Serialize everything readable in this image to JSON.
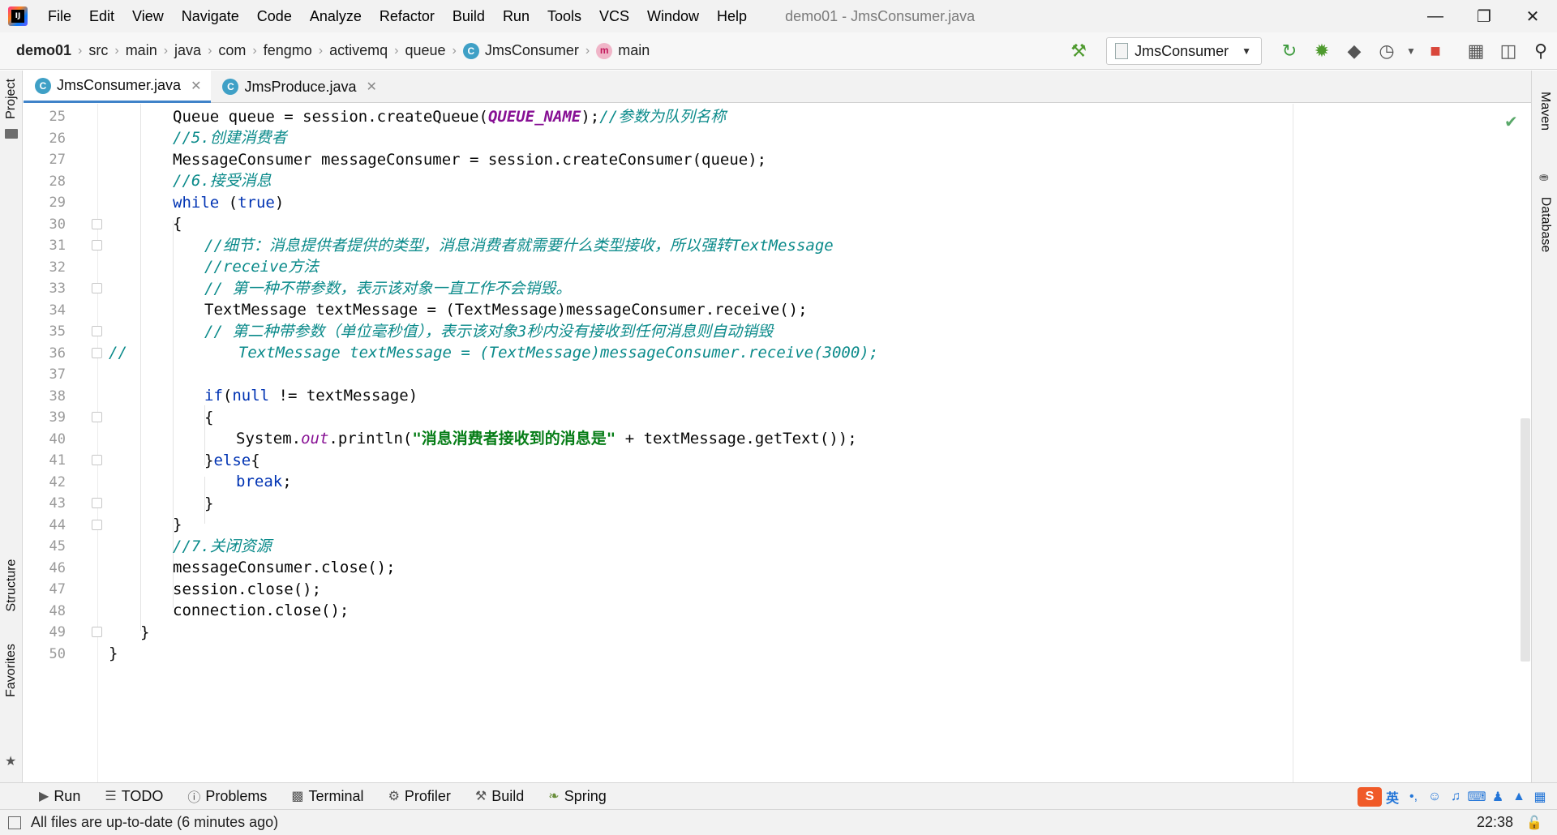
{
  "app": {
    "logo_text": "IJ",
    "window_title": "demo01 - JmsConsumer.java"
  },
  "menu": [
    "File",
    "Edit",
    "View",
    "Navigate",
    "Code",
    "Analyze",
    "Refactor",
    "Build",
    "Run",
    "Tools",
    "VCS",
    "Window",
    "Help"
  ],
  "breadcrumb": {
    "items": [
      "demo01",
      "src",
      "main",
      "java",
      "com",
      "fengmo",
      "activemq",
      "queue"
    ],
    "class_name": "JmsConsumer",
    "method_name": "main"
  },
  "toolbar": {
    "run_config": "JmsConsumer",
    "icons": [
      "build-hammer-icon",
      "rerun-icon",
      "debug-icon",
      "coverage-icon",
      "profile-icon",
      "stop-icon",
      "project-structure-icon",
      "terminal-icon",
      "search-icon"
    ]
  },
  "left_strip": {
    "project_label": "Project",
    "structure_label": "Structure",
    "favorites_label": "Favorites"
  },
  "right_strip": {
    "maven_label": "Maven",
    "database_label": "Database"
  },
  "tabs": [
    {
      "label": "JmsConsumer.java",
      "active": true
    },
    {
      "label": "JmsProduce.java",
      "active": false
    }
  ],
  "editor": {
    "lines": [
      {
        "n": "25",
        "indent": 2
      },
      {
        "n": "26",
        "indent": 2
      },
      {
        "n": "27",
        "indent": 2
      },
      {
        "n": "28",
        "indent": 2
      },
      {
        "n": "29",
        "indent": 2
      },
      {
        "n": "30",
        "indent": 2
      },
      {
        "n": "31",
        "indent": 3
      },
      {
        "n": "32",
        "indent": 3
      },
      {
        "n": "33",
        "indent": 3
      },
      {
        "n": "34",
        "indent": 3
      },
      {
        "n": "35",
        "indent": 3
      },
      {
        "n": "36",
        "indent": 0
      },
      {
        "n": "37",
        "indent": 0
      },
      {
        "n": "38",
        "indent": 3
      },
      {
        "n": "39",
        "indent": 3
      },
      {
        "n": "40",
        "indent": 4
      },
      {
        "n": "41",
        "indent": 3
      },
      {
        "n": "42",
        "indent": 4
      },
      {
        "n": "43",
        "indent": 3
      },
      {
        "n": "44",
        "indent": 2
      },
      {
        "n": "45",
        "indent": 2
      },
      {
        "n": "46",
        "indent": 2
      },
      {
        "n": "47",
        "indent": 2
      },
      {
        "n": "48",
        "indent": 2
      },
      {
        "n": "49",
        "indent": 1
      },
      {
        "n": "50",
        "indent": 0
      }
    ],
    "code": {
      "l25a": "Queue queue = session.createQueue(",
      "l25b": "QUEUE_NAME",
      "l25c": ");",
      "l25d": "//参数为队列名称",
      "l26": "//5.创建消费者",
      "l27": "MessageConsumer messageConsumer = session.createConsumer(queue);",
      "l28": "//6.接受消息",
      "l29a": "while",
      "l29b": " (",
      "l29c": "true",
      "l29d": ")",
      "l30": "{",
      "l31": "//细节：消息提供者提供的类型，消息消费者就需要什么类型接收，所以强转TextMessage",
      "l32": "//receive方法",
      "l33": "// 第一种不带参数，表示该对象一直工作不会销毁。",
      "l34": "TextMessage textMessage = (TextMessage)messageConsumer.receive();",
      "l35": "// 第二种带参数（单位毫秒值），表示该对象3秒内没有接收到任何消息则自动销毁",
      "l36a": "//",
      "l36b": "TextMessage textMessage = (TextMessage)messageConsumer.receive(3000);",
      "l38a": "if",
      "l38b": "(",
      "l38c": "null",
      "l38d": " != textMessage)",
      "l39": "{",
      "l40a": "System.",
      "l40b": "out",
      "l40c": ".println(",
      "l40d": "\"消息消费者接收到的消息是\"",
      "l40e": " + textMessage.getText());",
      "l41a": "}",
      "l41b": "else",
      "l41c": "{",
      "l42": "break",
      "l42b": ";",
      "l43": "}",
      "l44": "}",
      "l45": "//7.关闭资源",
      "l46": "messageConsumer.close();",
      "l47": "session.close();",
      "l48": "connection.close();",
      "l49": "}",
      "l50": "}"
    },
    "inspection_status": "ok"
  },
  "bottom_tools": [
    {
      "label": "Run",
      "icon": "run-icon"
    },
    {
      "label": "TODO",
      "icon": "todo-list-icon"
    },
    {
      "label": "Problems",
      "icon": "problems-icon"
    },
    {
      "label": "Terminal",
      "icon": "terminal-icon"
    },
    {
      "label": "Profiler",
      "icon": "profiler-icon"
    },
    {
      "label": "Build",
      "icon": "build-hammer-icon"
    },
    {
      "label": "Spring",
      "icon": "spring-leaf-icon"
    }
  ],
  "ime": {
    "brand": "S",
    "lang": "英",
    "punct": "•,",
    "icons": [
      "emoji-icon",
      "mic-icon",
      "keyboard-icon",
      "user-icon",
      "shirt-icon",
      "grid-icon"
    ]
  },
  "status": {
    "message": "All files are up-to-date (6 minutes ago)",
    "time": "22:38"
  }
}
